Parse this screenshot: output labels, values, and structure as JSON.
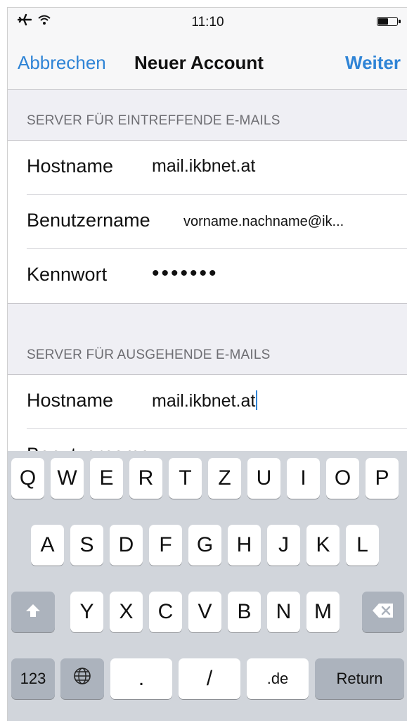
{
  "status_bar": {
    "time": "11:10",
    "airplane_icon": "airplane-icon",
    "wifi_icon": "wifi-icon",
    "battery_icon": "battery-icon"
  },
  "nav": {
    "cancel_label": "Abbrechen",
    "title": "Neuer Account",
    "next_label": "Weiter"
  },
  "incoming": {
    "header": "SERVER FÜR EINTREFFENDE E-MAILS",
    "rows": [
      {
        "label": "Hostname",
        "value": "mail.ikbnet.at"
      },
      {
        "label": "Benutzername",
        "value": "vorname.nachname@ik..."
      },
      {
        "label": "Kennwort",
        "value": "•••••••"
      }
    ]
  },
  "outgoing": {
    "header": "SERVER FÜR AUSGEHENDE E-MAILS",
    "rows": [
      {
        "label": "Hostname",
        "value": "mail.ikbnet.at"
      },
      {
        "label": "Benutzername",
        "value": ""
      }
    ]
  },
  "keyboard": {
    "row1": [
      "Q",
      "W",
      "E",
      "R",
      "T",
      "Z",
      "U",
      "I",
      "O",
      "P"
    ],
    "row2": [
      "A",
      "S",
      "D",
      "F",
      "G",
      "H",
      "J",
      "K",
      "L"
    ],
    "row3": [
      "Y",
      "X",
      "C",
      "V",
      "B",
      "N",
      "M"
    ],
    "shift_icon": "shift-icon",
    "delete_icon": "backspace-icon",
    "numbers_label": "123",
    "globe_icon": "globe-icon",
    "dot_label": ".",
    "slash_label": "/",
    "de_label": ".de",
    "return_label": "Return"
  }
}
